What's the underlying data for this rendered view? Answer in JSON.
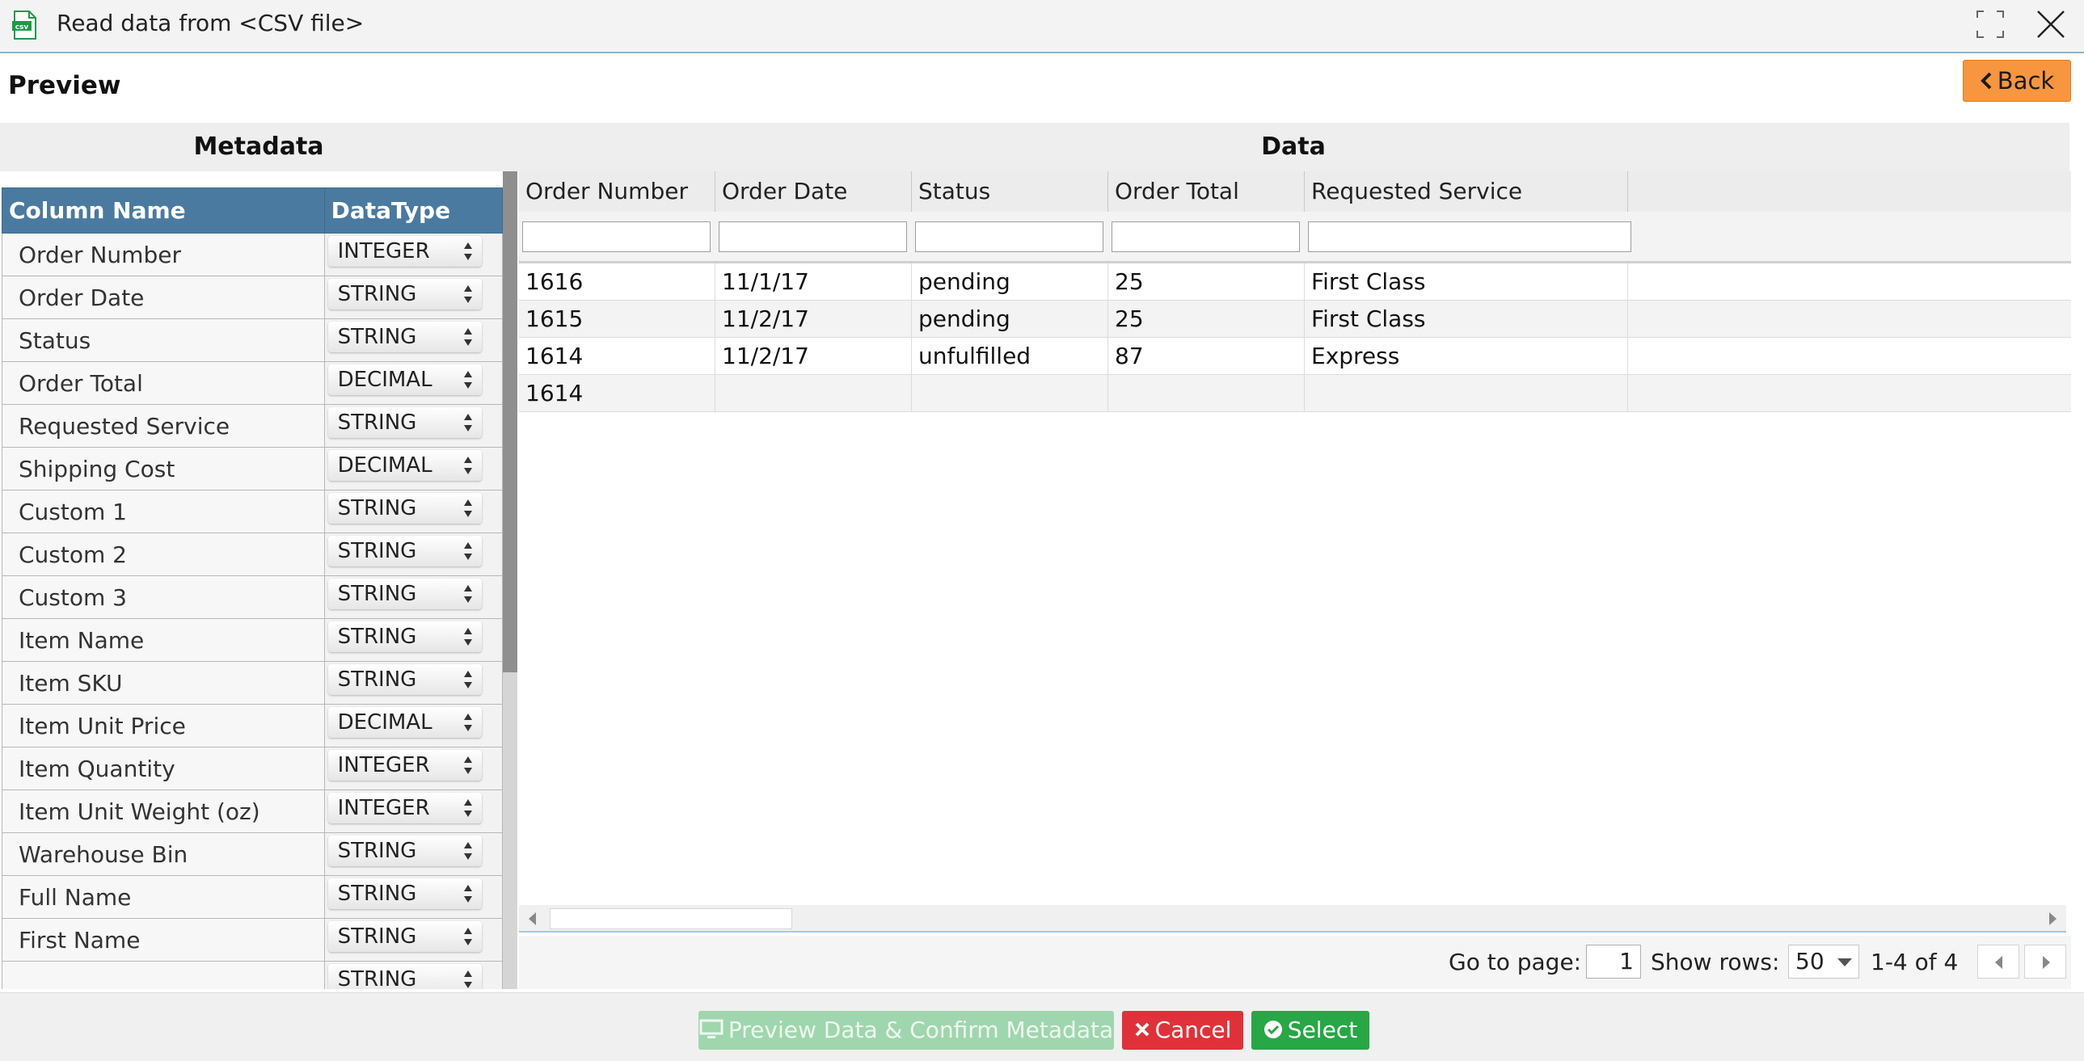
{
  "window": {
    "title": "Read data from <CSV file>",
    "icon": "csv-file-icon"
  },
  "header": {
    "title": "Preview",
    "back_label": "Back"
  },
  "sections": {
    "metadata": "Metadata",
    "data": "Data"
  },
  "metadata": {
    "headers": {
      "column_name": "Column Name",
      "datatype": "DataType"
    },
    "rows": [
      {
        "name": "Order Number",
        "type": "INTEGER"
      },
      {
        "name": "Order Date",
        "type": "STRING"
      },
      {
        "name": "Status",
        "type": "STRING"
      },
      {
        "name": "Order Total",
        "type": "DECIMAL"
      },
      {
        "name": "Requested Service",
        "type": "STRING"
      },
      {
        "name": "Shipping Cost",
        "type": "DECIMAL"
      },
      {
        "name": "Custom 1",
        "type": "STRING"
      },
      {
        "name": "Custom 2",
        "type": "STRING"
      },
      {
        "name": "Custom 3",
        "type": "STRING"
      },
      {
        "name": "Item Name",
        "type": "STRING"
      },
      {
        "name": "Item SKU",
        "type": "STRING"
      },
      {
        "name": "Item Unit Price",
        "type": "DECIMAL"
      },
      {
        "name": "Item Quantity",
        "type": "INTEGER"
      },
      {
        "name": "Item Unit Weight (oz)",
        "type": "INTEGER"
      },
      {
        "name": "Warehouse Bin",
        "type": "STRING"
      },
      {
        "name": "Full Name",
        "type": "STRING"
      },
      {
        "name": "First Name",
        "type": "STRING"
      },
      {
        "name": "",
        "type": "STRING"
      }
    ]
  },
  "grid": {
    "columns": [
      "Order Number",
      "Order Date",
      "Status",
      "Order Total",
      "Requested Service"
    ],
    "rows": [
      [
        "1616",
        "11/1/17",
        "pending",
        "25",
        "First Class"
      ],
      [
        "1615",
        "11/2/17",
        "pending",
        "25",
        "First Class"
      ],
      [
        "1614",
        "11/2/17",
        "unfulfilled",
        "87",
        "Express"
      ],
      [
        "1614",
        "",
        "",
        "",
        ""
      ]
    ]
  },
  "pager": {
    "go_to_label": "Go to page:",
    "page": "1",
    "show_rows_label": "Show rows:",
    "rows_per_page": "50",
    "range": "1-4 of 4"
  },
  "footer": {
    "preview_label": "Preview Data & Confirm Metadata",
    "cancel_label": "Cancel",
    "select_label": "Select"
  },
  "colors": {
    "accent_orange": "#f7963f",
    "header_blue": "#4a7aa0",
    "cancel_red": "#e0313a",
    "select_green": "#27a745",
    "preview_green_disabled": "#9fd6ad"
  }
}
